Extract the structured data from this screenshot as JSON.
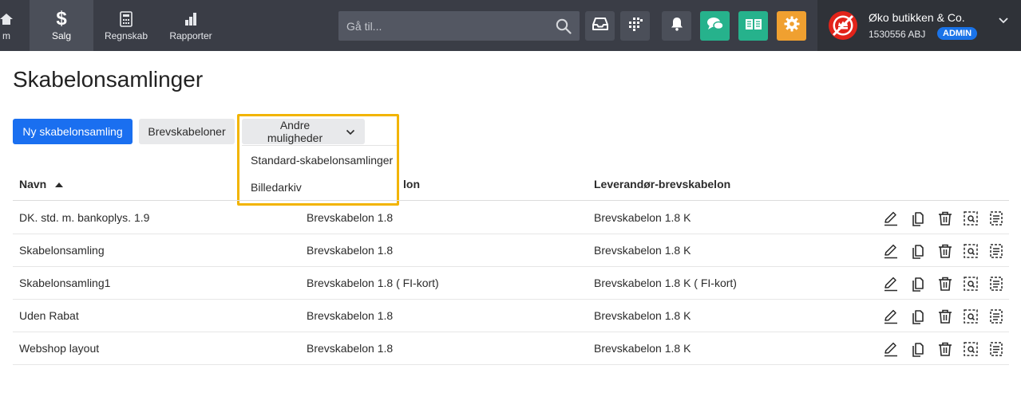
{
  "nav": {
    "items": [
      {
        "label": "m",
        "icon": "home-icon"
      },
      {
        "label": "Salg",
        "icon": "dollar-icon",
        "active": true
      },
      {
        "label": "Regnskab",
        "icon": "calculator-icon"
      },
      {
        "label": "Rapporter",
        "icon": "bar-chart-icon"
      }
    ]
  },
  "search": {
    "placeholder": "Gå til..."
  },
  "toolbar": {
    "buttons": [
      {
        "icon": "inbox-icon",
        "color": "#4b4f59"
      },
      {
        "icon": "apps-icon",
        "color": "#4b4f59"
      },
      {
        "icon": "bell-icon",
        "color": "#4b4f59"
      },
      {
        "icon": "chat-icon",
        "color": "#26b28c"
      },
      {
        "icon": "book-icon",
        "color": "#26b28c"
      },
      {
        "icon": "gear-icon",
        "color": "#f0a030"
      }
    ]
  },
  "account": {
    "name": "Øko butikken & Co.",
    "id": "1530556 ABJ",
    "role": "ADMIN"
  },
  "page": {
    "title": "Skabelonsamlinger"
  },
  "actions": {
    "new_label": "Ny skabelonsamling",
    "letter_templates_label": "Brevskabeloner",
    "more_label": "Andre muligheder",
    "more_menu": [
      "Standard-skabelonsamlinger",
      "Billedarkiv"
    ]
  },
  "table": {
    "headers": [
      "Navn",
      "lon",
      "Leverandør-brevskabelon"
    ],
    "rows": [
      [
        "DK. std. m. bankoplys. 1.9",
        "Brevskabelon 1.8",
        "Brevskabelon 1.8 K"
      ],
      [
        "Skabelonsamling",
        "Brevskabelon 1.8",
        "Brevskabelon 1.8 K"
      ],
      [
        "Skabelonsamling1",
        "Brevskabelon 1.8 ( FI-kort)",
        "Brevskabelon 1.8 K ( FI-kort)"
      ],
      [
        "Uden Rabat",
        "Brevskabelon 1.8",
        "Brevskabelon 1.8 K"
      ],
      [
        "Webshop layout",
        "Brevskabelon 1.8",
        "Brevskabelon 1.8 K"
      ]
    ],
    "row_actions": [
      "edit-icon",
      "copy-icon",
      "trash-icon",
      "preview-icon",
      "details-icon"
    ]
  },
  "colors": {
    "topbar": "#3a3d46",
    "primary": "#1a6ff0",
    "highlight": "#f2b400",
    "admin_badge": "#1a73e8"
  }
}
